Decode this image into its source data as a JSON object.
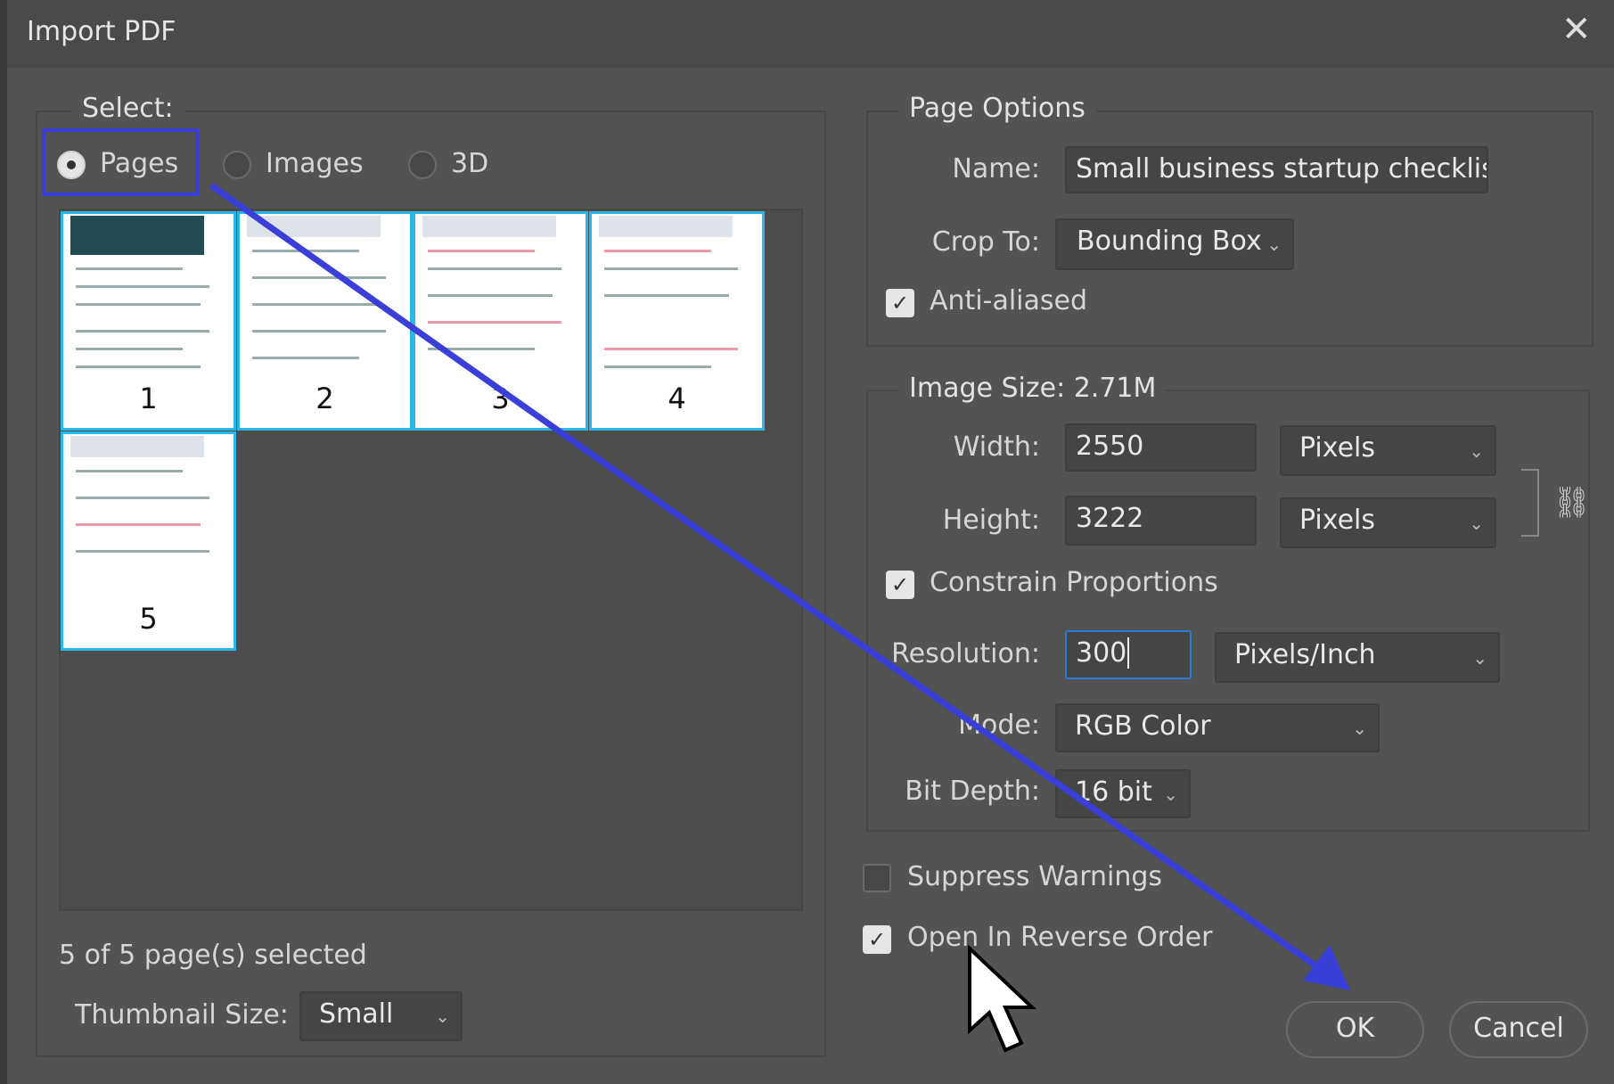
{
  "dialog": {
    "title": "Import PDF",
    "close_icon": "close-icon"
  },
  "select": {
    "legend": "Select:",
    "options": [
      {
        "label": "Pages",
        "selected": true
      },
      {
        "label": "Images",
        "selected": false
      },
      {
        "label": "3D",
        "selected": false
      }
    ]
  },
  "thumbnails": [
    {
      "page": "1"
    },
    {
      "page": "2"
    },
    {
      "page": "3"
    },
    {
      "page": "4"
    },
    {
      "page": "5"
    }
  ],
  "selection_status": "5 of 5 page(s) selected",
  "thumbnail_size": {
    "label": "Thumbnail Size:",
    "value": "Small"
  },
  "page_options": {
    "legend": "Page Options",
    "name_label": "Name:",
    "name_value": "Small business startup checklist.",
    "crop_label": "Crop To:",
    "crop_value": "Bounding Box",
    "anti_aliased_label": "Anti-aliased",
    "anti_aliased": true
  },
  "image_size": {
    "legend": "Image Size: 2.71M",
    "width_label": "Width:",
    "width_value": "2550",
    "width_unit": "Pixels",
    "height_label": "Height:",
    "height_value": "3222",
    "height_unit": "Pixels",
    "constrain_label": "Constrain Proportions",
    "constrain": true,
    "resolution_label": "Resolution:",
    "resolution_value": "300",
    "resolution_unit": "Pixels/Inch",
    "mode_label": "Mode:",
    "mode_value": "RGB Color",
    "bit_depth_label": "Bit Depth:",
    "bit_depth_value": "16 bit"
  },
  "options": {
    "suppress_label": "Suppress Warnings",
    "suppress": false,
    "reverse_label": "Open In Reverse Order",
    "reverse": true
  },
  "buttons": {
    "ok": "OK",
    "cancel": "Cancel"
  },
  "colors": {
    "annotation": "#3a3fd8",
    "thumb_border": "#2ab6e6"
  }
}
